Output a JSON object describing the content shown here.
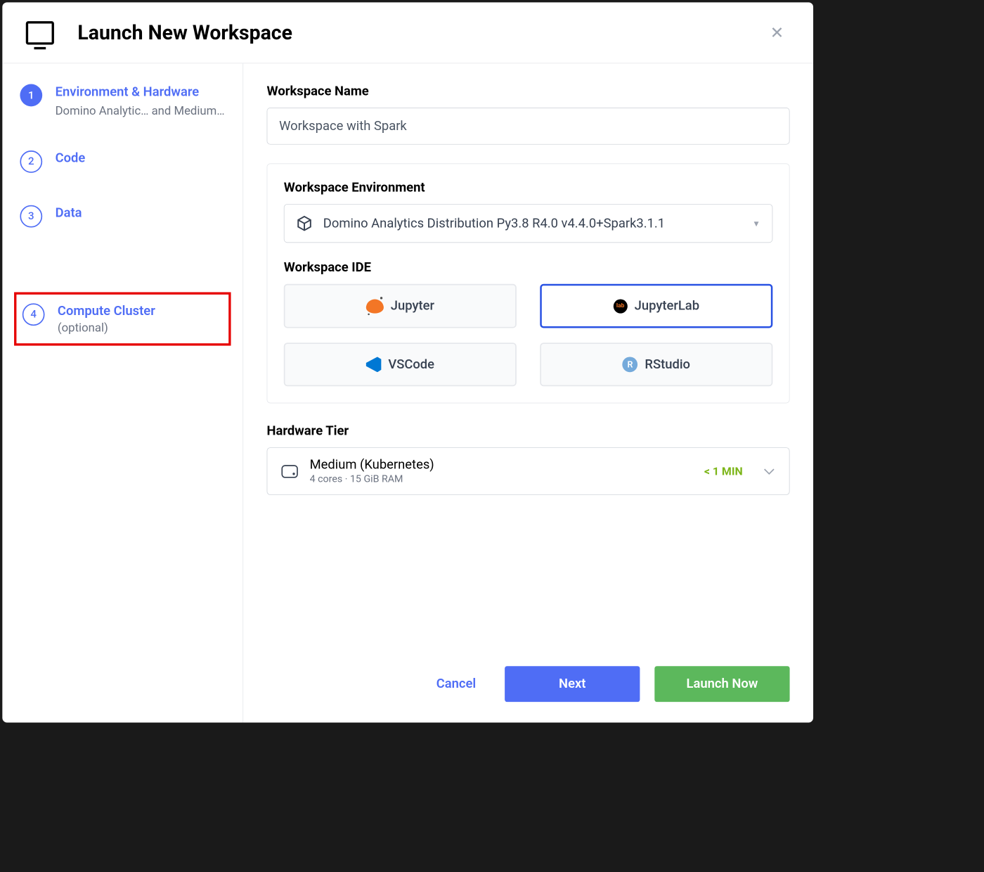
{
  "modal": {
    "title": "Launch New Workspace"
  },
  "sidebar": {
    "steps": [
      {
        "num": "1",
        "title": "Environment & Hardware",
        "sub": "Domino Analytic… and Medium…",
        "optional": ""
      },
      {
        "num": "2",
        "title": "Code",
        "sub": "",
        "optional": ""
      },
      {
        "num": "3",
        "title": "Data",
        "sub": "",
        "optional": ""
      },
      {
        "num": "4",
        "title": "Compute Cluster",
        "sub": "",
        "optional": "(optional)"
      }
    ]
  },
  "main": {
    "workspace_name_label": "Workspace Name",
    "workspace_name_value": "Workspace with Spark",
    "env_label": "Workspace Environment",
    "env_value": "Domino Analytics Distribution Py3.8 R4.0 v4.4.0+Spark3.1.1",
    "ide_label": "Workspace IDE",
    "ides": [
      {
        "name": "Jupyter"
      },
      {
        "name": "JupyterLab"
      },
      {
        "name": "VSCode"
      },
      {
        "name": "RStudio"
      }
    ],
    "hw_label": "Hardware Tier",
    "hw_title": "Medium (Kubernetes)",
    "hw_sub": "4 cores · 15 GiB RAM",
    "hw_time": "< 1 MIN"
  },
  "footer": {
    "cancel": "Cancel",
    "next": "Next",
    "launch": "Launch Now"
  }
}
